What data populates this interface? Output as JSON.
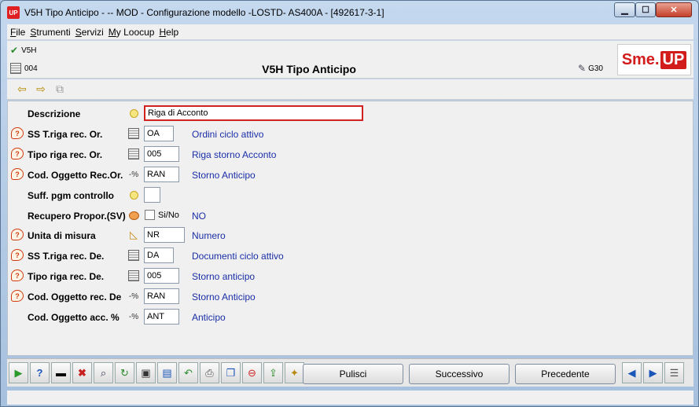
{
  "window": {
    "title": "V5H Tipo Anticipo -  -- MOD - Configurazione modello -LOSTD- AS400A - [492617-3-1]",
    "app_icon": "UP",
    "controls": [
      "minimize-icon",
      "maximize-icon",
      "close-icon"
    ]
  },
  "menu": [
    "File",
    "Strumenti",
    "Servizi",
    "My Loocup",
    "Help"
  ],
  "header": {
    "code_top": "V5H",
    "code_bottom": "004",
    "title": "V5H Tipo Anticipo",
    "right_code": "G30",
    "logo_sme": "Sme.",
    "logo_up": "UP"
  },
  "form": {
    "rows": [
      {
        "label": "Descrizione",
        "value": "Riga di Acconto",
        "desc": ""
      },
      {
        "label": "SS T.riga rec. Or.",
        "value": "OA",
        "desc": "Ordini ciclo attivo"
      },
      {
        "label": "Tipo riga rec. Or.",
        "value": "005",
        "desc": "Riga storno Acconto"
      },
      {
        "label": "Cod. Oggetto Rec.Or.",
        "value": "RAN",
        "desc": "Storno Anticipo",
        "prefix": "-%"
      },
      {
        "label": "Suff. pgm controllo",
        "value": "",
        "desc": ""
      },
      {
        "label": "Recupero Propor.(SV)",
        "checkbox_label": "Si/No",
        "desc": "NO"
      },
      {
        "label": "Unita di misura",
        "value": "NR",
        "desc": "Numero"
      },
      {
        "label": "SS T.riga rec. De.",
        "value": "DA",
        "desc": "Documenti ciclo attivo"
      },
      {
        "label": "Tipo riga rec. De.",
        "value": "005",
        "desc": "Storno anticipo"
      },
      {
        "label": "Cod. Oggetto rec. De",
        "value": "RAN",
        "desc": "Storno Anticipo",
        "prefix": "-%"
      },
      {
        "label": "Cod. Oggetto acc. %",
        "value": "ANT",
        "desc": "Anticipo",
        "prefix": "-%"
      }
    ]
  },
  "buttons": {
    "clear": "Pulisci",
    "next": "Successivo",
    "prev": "Precedente"
  },
  "colors": {
    "description_blue": "#1a2ea8",
    "brand_red": "#d21c1c",
    "focus_border": "#d02020"
  }
}
